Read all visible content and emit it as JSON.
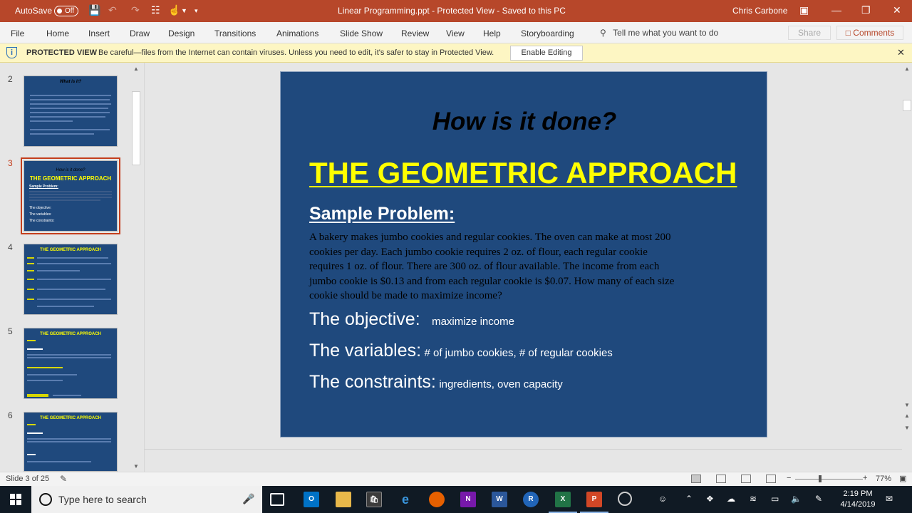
{
  "titlebar": {
    "autosave_label": "AutoSave",
    "autosave_state": "Off",
    "document_title": "Linear Programming.ppt  -  Protected View  -  Saved to this PC",
    "user": "Chris Carbone"
  },
  "ribbon": {
    "tabs": [
      "File",
      "Home",
      "Insert",
      "Draw",
      "Design",
      "Transitions",
      "Animations",
      "Slide Show",
      "Review",
      "View",
      "Help",
      "Storyboarding"
    ],
    "tell_me": "Tell me what you want to do",
    "share": "Share",
    "comments": "Comments"
  },
  "protected_view": {
    "label": "PROTECTED VIEW",
    "message": "Be careful—files from the Internet can contain viruses. Unless you need to edit, it's safer to stay in Protected View.",
    "enable_button": "Enable Editing"
  },
  "thumbnails": {
    "numbers": [
      "2",
      "3",
      "4",
      "5",
      "6"
    ],
    "slide2_title": "What is it?",
    "slide3_title": "How is it done?",
    "slide3_heading": "THE GEOMETRIC APPROACH",
    "slide3_sample": "Sample Problem:",
    "slide3_obj": "The objective:",
    "slide3_var": "The variables:",
    "slide3_con": "The constraints:",
    "slide4_title": "THE GEOMETRIC APPROACH",
    "slide5_title": "THE GEOMETRIC APPROACH",
    "slide6_title": "THE GEOMETRIC APPROACH",
    "selected_index": 1
  },
  "slide": {
    "question": "How is it done?",
    "heading": "THE GEOMETRIC APPROACH",
    "sample_label": "Sample Problem:",
    "problem_lines": [
      "A bakery makes jumbo cookies and regular cookies.  The oven can make at most 200",
      "cookies per day.  Each jumbo cookie requires 2 oz. of flour, each regular cookie",
      "requires 1 oz. of flour.  There are 300 oz. of flour available.  The income from each",
      "jumbo cookie is $0.13 and from each regular cookie is $0.07.  How many of each size",
      "cookie should be made to maximize income?"
    ],
    "objective_label": "The objective:",
    "objective_value": "maximize income",
    "variables_label": "The variables:",
    "variables_value": "# of jumbo cookies, # of regular cookies",
    "constraints_label": "The constraints:",
    "constraints_value": "ingredients, oven capacity"
  },
  "status": {
    "slide_number": "Slide 3 of 25",
    "zoom": "77%"
  },
  "taskbar": {
    "search_placeholder": "Type here to search",
    "time": "2:19 PM",
    "date": "4/14/2019"
  },
  "colors": {
    "accent": "#b7472a",
    "slide_bg": "#1f497d",
    "heading_yellow": "#ffff00",
    "protected_bg": "#fdf6c3"
  }
}
